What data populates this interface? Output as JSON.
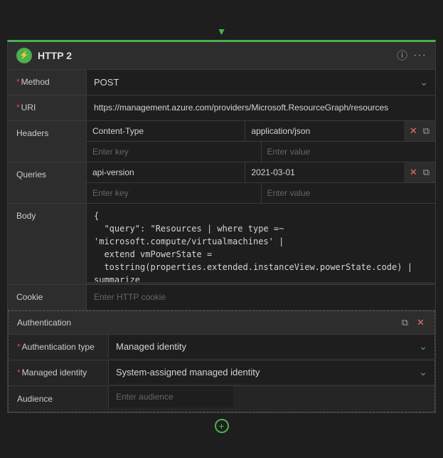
{
  "header": {
    "title": "HTTP 2",
    "icon": "⚡",
    "info_label": "ℹ",
    "more_label": "···"
  },
  "fields": {
    "method": {
      "label": "Method",
      "required": true,
      "value": "POST"
    },
    "uri": {
      "label": "URI",
      "required": true,
      "value": "https://management.azure.com/providers/Microsoft.ResourceGraph/resources"
    },
    "headers": {
      "label": "Headers",
      "rows": [
        {
          "key": "Content-Type",
          "value": "application/json"
        },
        {
          "key": "",
          "value": ""
        }
      ],
      "key_placeholder": "Enter key",
      "value_placeholder": "Enter value"
    },
    "queries": {
      "label": "Queries",
      "rows": [
        {
          "key": "api-version",
          "value": "2021-03-01"
        },
        {
          "key": "",
          "value": ""
        }
      ],
      "key_placeholder": "Enter key",
      "value_placeholder": "Enter value"
    },
    "body": {
      "label": "Body",
      "value": "{\n  \"query\": \"Resources | where type =~ 'microsoft.compute/virtualmachines' |\n  extend vmPowerState =\n  tostring(properties.extended.instanceView.powerState.code) | summarize\n  count() by vmPowerState\"\n}"
    },
    "cookie": {
      "label": "Cookie",
      "placeholder": "Enter HTTP cookie"
    }
  },
  "authentication": {
    "section_label": "Authentication",
    "auth_type": {
      "label": "Authentication type",
      "required": true,
      "value": "Managed identity"
    },
    "managed_identity": {
      "label": "Managed identity",
      "required": true,
      "value": "System-assigned managed identity"
    },
    "audience": {
      "label": "Audience",
      "placeholder": "Enter audience"
    }
  },
  "icons": {
    "chevron_down": "⌄",
    "close": "✕",
    "clone": "⧉",
    "info": "ⓘ",
    "more": "…"
  }
}
